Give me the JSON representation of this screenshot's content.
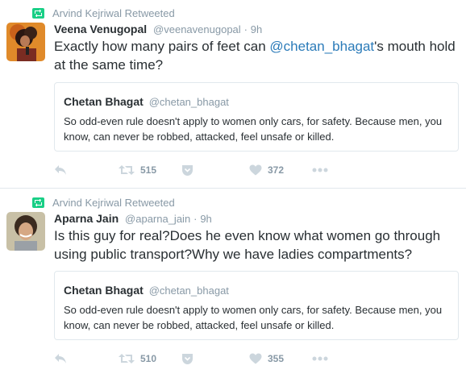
{
  "tweets": [
    {
      "retweeted_by": "Arvind Kejriwal Retweeted",
      "name": "Veena Venugopal",
      "handle": "@veenavenugopal",
      "dot": "·",
      "time": "9h",
      "text_before": "Exactly how many pairs of feet can ",
      "text_mention": "@chetan_bhagat",
      "text_after": "'s mouth hold at the same time?",
      "quote": {
        "name": "Chetan Bhagat",
        "handle": "@chetan_bhagat",
        "text": "So odd-even rule doesn't apply to women only cars, for safety. Because men, you know, can never be robbed, attacked, feel unsafe or killed."
      },
      "retweets": "515",
      "likes": "372"
    },
    {
      "retweeted_by": "Arvind Kejriwal Retweeted",
      "name": "Aparna Jain",
      "handle": "@aparna_jain",
      "dot": "·",
      "time": "9h",
      "text": "Is this guy for real?Does he even know what women go through using public transport?Why we have ladies compartments?",
      "quote": {
        "name": "Chetan Bhagat",
        "handle": "@chetan_bhagat",
        "text": "So odd-even rule doesn't apply to women only cars, for safety. Because men, you know, can never be robbed, attacked, feel unsafe or killed."
      },
      "retweets": "510",
      "likes": "355"
    }
  ],
  "colors": {
    "name": "#292f33",
    "meta": "#8899a6",
    "mention": "#2b7bb9",
    "retweet_badge": "#19cf86",
    "border": "#e1e8ed",
    "icon": "#ccd6dd"
  },
  "icons": [
    "retweet-badge-icon",
    "reply-icon",
    "retweet-icon",
    "more-options-icon",
    "heart-icon",
    "more-dots-icon"
  ]
}
